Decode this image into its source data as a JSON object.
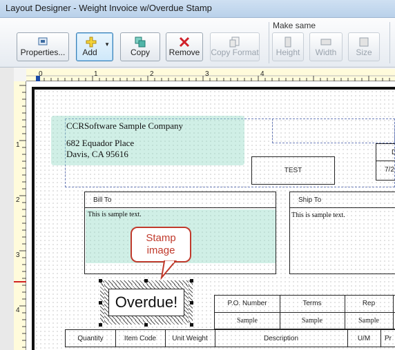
{
  "window": {
    "title": "Layout Designer - Weight Invoice w/Overdue Stamp"
  },
  "toolbar": {
    "properties": "Properties...",
    "add": "Add",
    "copy": "Copy",
    "remove": "Remove",
    "copy_format": "Copy Format",
    "make_same_label": "Make same",
    "height": "Height",
    "width": "Width",
    "size": "Size"
  },
  "ruler": {
    "h_marks": [
      "0",
      "1",
      "2",
      "3",
      "4"
    ],
    "v_marks": [
      "1",
      "2",
      "3",
      "4"
    ]
  },
  "company": {
    "name": "CCRSoftware Sample Company",
    "address1": "682 Equador Place",
    "address2": "Davis, CA 95616"
  },
  "test_label": "TEST",
  "partial_date_top": "D",
  "partial_date_val": "7/2",
  "bill_to": {
    "title": "Bill To",
    "body": "This is sample text."
  },
  "ship_to": {
    "title": "Ship To",
    "body": "This is sample text."
  },
  "callout": {
    "line1": "Stamp",
    "line2": "image"
  },
  "stamp": {
    "text": "Overdue!"
  },
  "po_table": {
    "headers": [
      "P.O. Number",
      "Terms",
      "Rep"
    ],
    "values": [
      "Sample",
      "Sample",
      "Sample"
    ]
  },
  "items_table": {
    "headers": [
      "Quantity",
      "Item Code",
      "Unit Weight",
      "Description",
      "U/M",
      "Pr"
    ]
  },
  "colors": {
    "accent": "#c0392b",
    "teal": "#96dcc8"
  }
}
